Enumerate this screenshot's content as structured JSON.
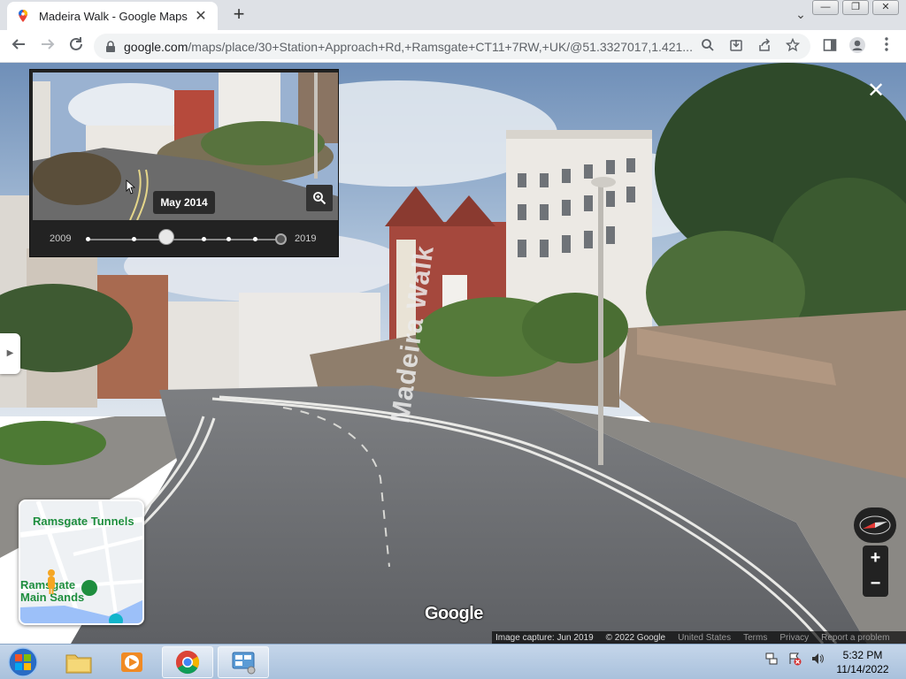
{
  "browser": {
    "tab": {
      "title": "Madeira Walk - Google Maps",
      "close": "✕"
    },
    "new_tab": "+",
    "tab_dropdown": "⌄",
    "window_buttons": {
      "minimize": "—",
      "restore": "❐",
      "close": "✕"
    },
    "url_host": "google.com",
    "url_path": "/maps/place/30+Station+Approach+Rd,+Ramsgate+CT11+7RW,+UK/@51.3327017,1.421..."
  },
  "streetview": {
    "close": "✕",
    "road_label": "Madeira Walk",
    "time_travel": {
      "date_tooltip": "May 2014",
      "start_year": "2009",
      "end_year": "2019",
      "selected_position": 0.35
    },
    "minimap": {
      "labels": [
        "Ramsgate Tunnels",
        "Ramsgate Main Sands"
      ]
    },
    "zoom": {
      "in": "+",
      "out": "−"
    },
    "logo": "Google",
    "footer": {
      "capture": "Image capture: Jun 2019",
      "copyright": "© 2022 Google",
      "country": "United States",
      "terms": "Terms",
      "privacy": "Privacy",
      "report": "Report a problem"
    }
  },
  "taskbar": {
    "time": "5:32 PM",
    "date": "11/14/2022"
  },
  "colors": {
    "tab_strip": "#dee1e6",
    "omnibox": "#f1f3f4",
    "panel": "#222222",
    "taskbar": "#b8cde4"
  }
}
